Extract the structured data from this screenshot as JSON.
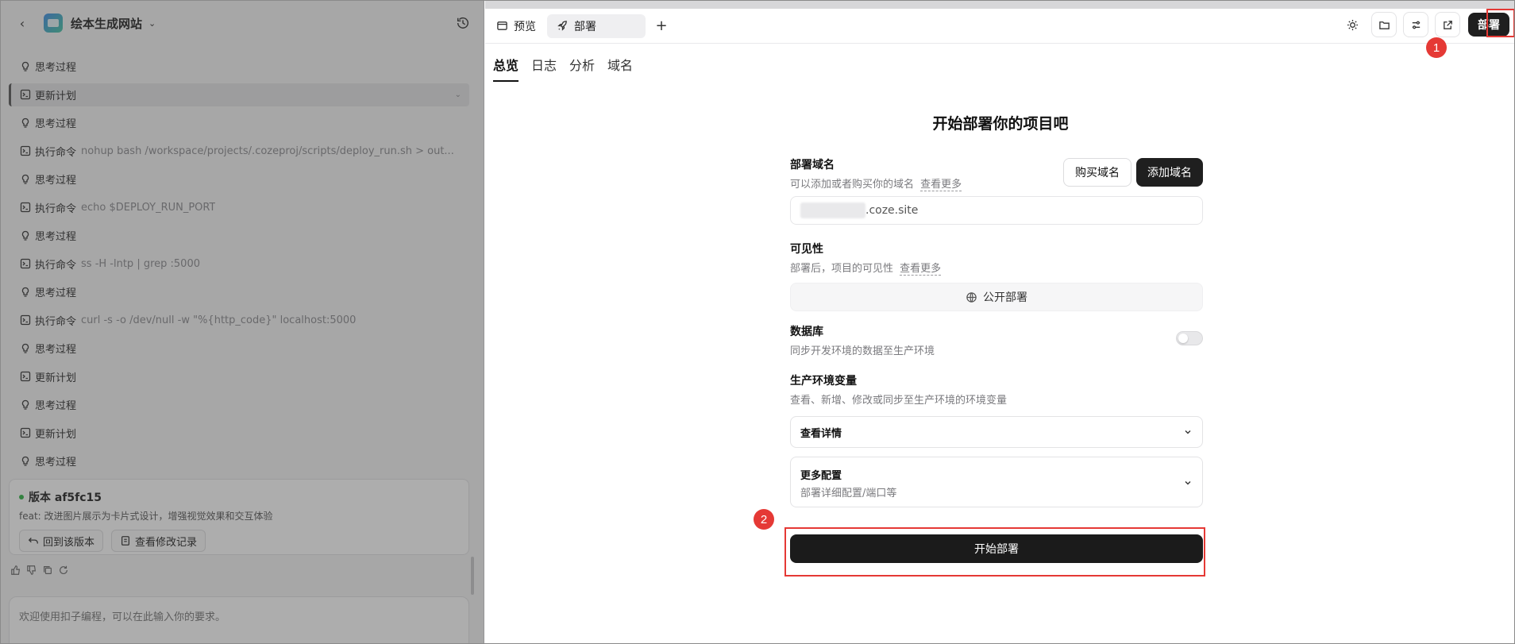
{
  "left_panel": {
    "app_title": "绘本生成网站",
    "steps": [
      {
        "type": "think",
        "label": "思考过程",
        "cmd": ""
      },
      {
        "type": "plan",
        "label": "更新计划",
        "cmd": "",
        "active": true
      },
      {
        "type": "think",
        "label": "思考过程",
        "cmd": ""
      },
      {
        "type": "cmd",
        "label": "执行命令",
        "cmd": "nohup bash /workspace/projects/.cozeproj/scripts/deploy_run.sh > out..."
      },
      {
        "type": "think",
        "label": "思考过程",
        "cmd": ""
      },
      {
        "type": "cmd",
        "label": "执行命令",
        "cmd": "echo $DEPLOY_RUN_PORT"
      },
      {
        "type": "think",
        "label": "思考过程",
        "cmd": ""
      },
      {
        "type": "cmd",
        "label": "执行命令",
        "cmd": "ss -H -lntp | grep :5000"
      },
      {
        "type": "think",
        "label": "思考过程",
        "cmd": ""
      },
      {
        "type": "cmd",
        "label": "执行命令",
        "cmd": "curl -s -o /dev/null -w \"%{http_code}\" localhost:5000"
      },
      {
        "type": "think",
        "label": "思考过程",
        "cmd": ""
      },
      {
        "type": "plan",
        "label": "更新计划",
        "cmd": ""
      },
      {
        "type": "think",
        "label": "思考过程",
        "cmd": ""
      },
      {
        "type": "plan",
        "label": "更新计划",
        "cmd": ""
      },
      {
        "type": "think",
        "label": "思考过程",
        "cmd": ""
      }
    ],
    "version": {
      "title": "版本 af5fc15",
      "desc": "feat: 改进图片展示为卡片式设计，增强视觉效果和交互体验",
      "revert_label": "回到该版本",
      "history_label": "查看修改记录"
    },
    "chat_placeholder": "欢迎使用扣子编程，可以在此输入你的要求。"
  },
  "right_panel": {
    "tabs": [
      {
        "label": "预览",
        "icon": "window-icon"
      },
      {
        "label": "部署",
        "icon": "rocket-icon",
        "active": true
      }
    ],
    "deploy_top_label": "部署",
    "badges": [
      "1",
      "2"
    ],
    "subtabs": [
      "总览",
      "日志",
      "分析",
      "域名"
    ],
    "heading": "开始部署你的项目吧",
    "domain": {
      "title": "部署域名",
      "desc": "可以添加或者购买你的域名",
      "more": "查看更多",
      "buy_label": "购买域名",
      "add_label": "添加域名",
      "suffix": ".coze.site"
    },
    "visibility": {
      "title": "可见性",
      "desc": "部署后，项目的可见性",
      "more": "查看更多",
      "value": "公开部署"
    },
    "database": {
      "title": "数据库",
      "desc": "同步开发环境的数据至生产环境",
      "enabled": false
    },
    "env": {
      "title": "生产环境变量",
      "desc": "查看、新增、修改或同步至生产环境的环境变量",
      "select_label": "查看详情"
    },
    "more_config": {
      "title": "更多配置",
      "desc": "部署详细配置/端口等"
    },
    "start_label": "开始部署"
  },
  "colors": {
    "accent_dark": "#1f1f1f",
    "highlight_red": "#e53935",
    "success_green": "#2fb344"
  }
}
